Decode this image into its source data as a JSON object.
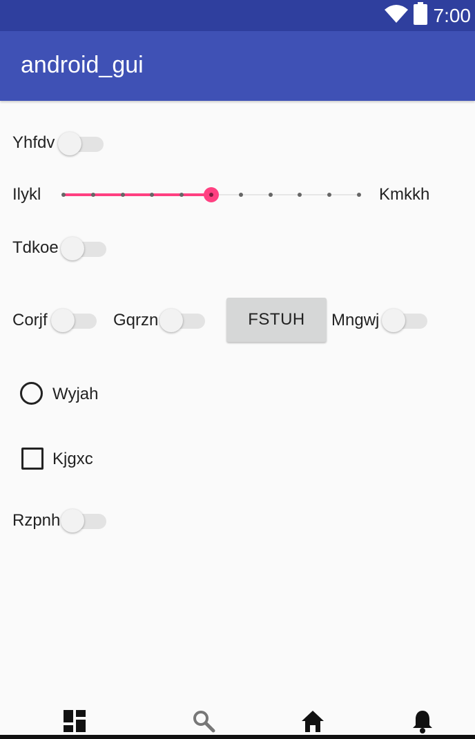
{
  "status_bar": {
    "time": "7:00"
  },
  "app_bar": {
    "title": "android_gui"
  },
  "controls": {
    "switch_1_label": "Yhfdv",
    "slider": {
      "min_label": "Ilykl",
      "max_label": "Kmkkh",
      "steps": 10,
      "value": 5
    },
    "switch_2_label": "Tdkoe",
    "switch_3_label": "Corjf",
    "switch_4_label": "Gqrzn",
    "button_label": "FSTUH",
    "switch_5_label": "Mngwj",
    "radio_label": "Wyjah",
    "checkbox_label": "Kjgxc",
    "switch_6_label": "Rzpnh"
  },
  "bottom_nav": {
    "items": [
      "dashboard-icon",
      "search-icon",
      "home-icon",
      "bell-icon"
    ]
  },
  "colors": {
    "status_bar": "#2f3f9e",
    "app_bar": "#3f51b5",
    "accent": "#ff4081",
    "background": "#fafafa"
  }
}
